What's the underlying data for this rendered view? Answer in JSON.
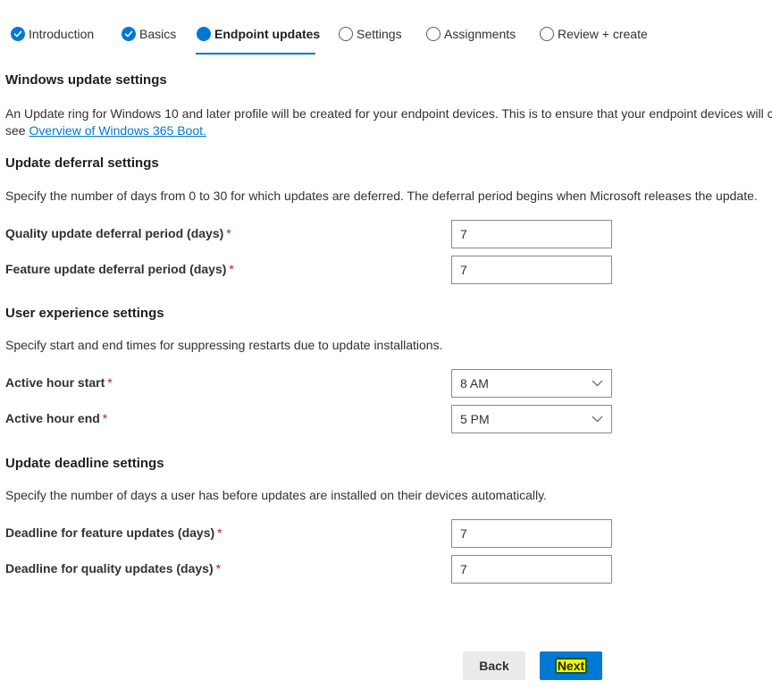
{
  "wizard": {
    "steps": [
      {
        "label": "Introduction",
        "state": "completed"
      },
      {
        "label": "Basics",
        "state": "completed"
      },
      {
        "label": "Endpoint updates",
        "state": "current"
      },
      {
        "label": "Settings",
        "state": "pending"
      },
      {
        "label": "Assignments",
        "state": "pending"
      },
      {
        "label": "Review + create",
        "state": "pending"
      }
    ]
  },
  "windows_update": {
    "heading": "Windows update settings",
    "description_line1": "An Update ring for Windows 10 and later profile will be created for your endpoint devices. This is to ensure that your endpoint devices will c",
    "description_line2_prefix": "see ",
    "link_text": "Overview of Windows 365 Boot."
  },
  "deferral": {
    "heading": "Update deferral settings",
    "description": "Specify the number of days from 0 to 30 for which updates are deferred. The deferral period begins when Microsoft releases the update.",
    "quality_label": "Quality update deferral period (days)",
    "quality_value": "7",
    "feature_label": "Feature update deferral period (days)",
    "feature_value": "7"
  },
  "user_experience": {
    "heading": "User experience settings",
    "description": "Specify start and end times for suppressing restarts due to update installations.",
    "start_label": "Active hour start",
    "start_value": "8 AM",
    "end_label": "Active hour end",
    "end_value": "5 PM"
  },
  "deadline": {
    "heading": "Update deadline settings",
    "description": "Specify the number of days a user has before updates are installed on their devices automatically.",
    "feature_label": "Deadline for feature updates (days)",
    "feature_value": "7",
    "quality_label": "Deadline for quality updates (days)",
    "quality_value": "7"
  },
  "required_marker": "*",
  "footer": {
    "back_label": "Back",
    "next_label": "Next"
  },
  "colors": {
    "accent": "#0078d4",
    "required": "#a4262c",
    "next_highlight": "#f5f500"
  }
}
